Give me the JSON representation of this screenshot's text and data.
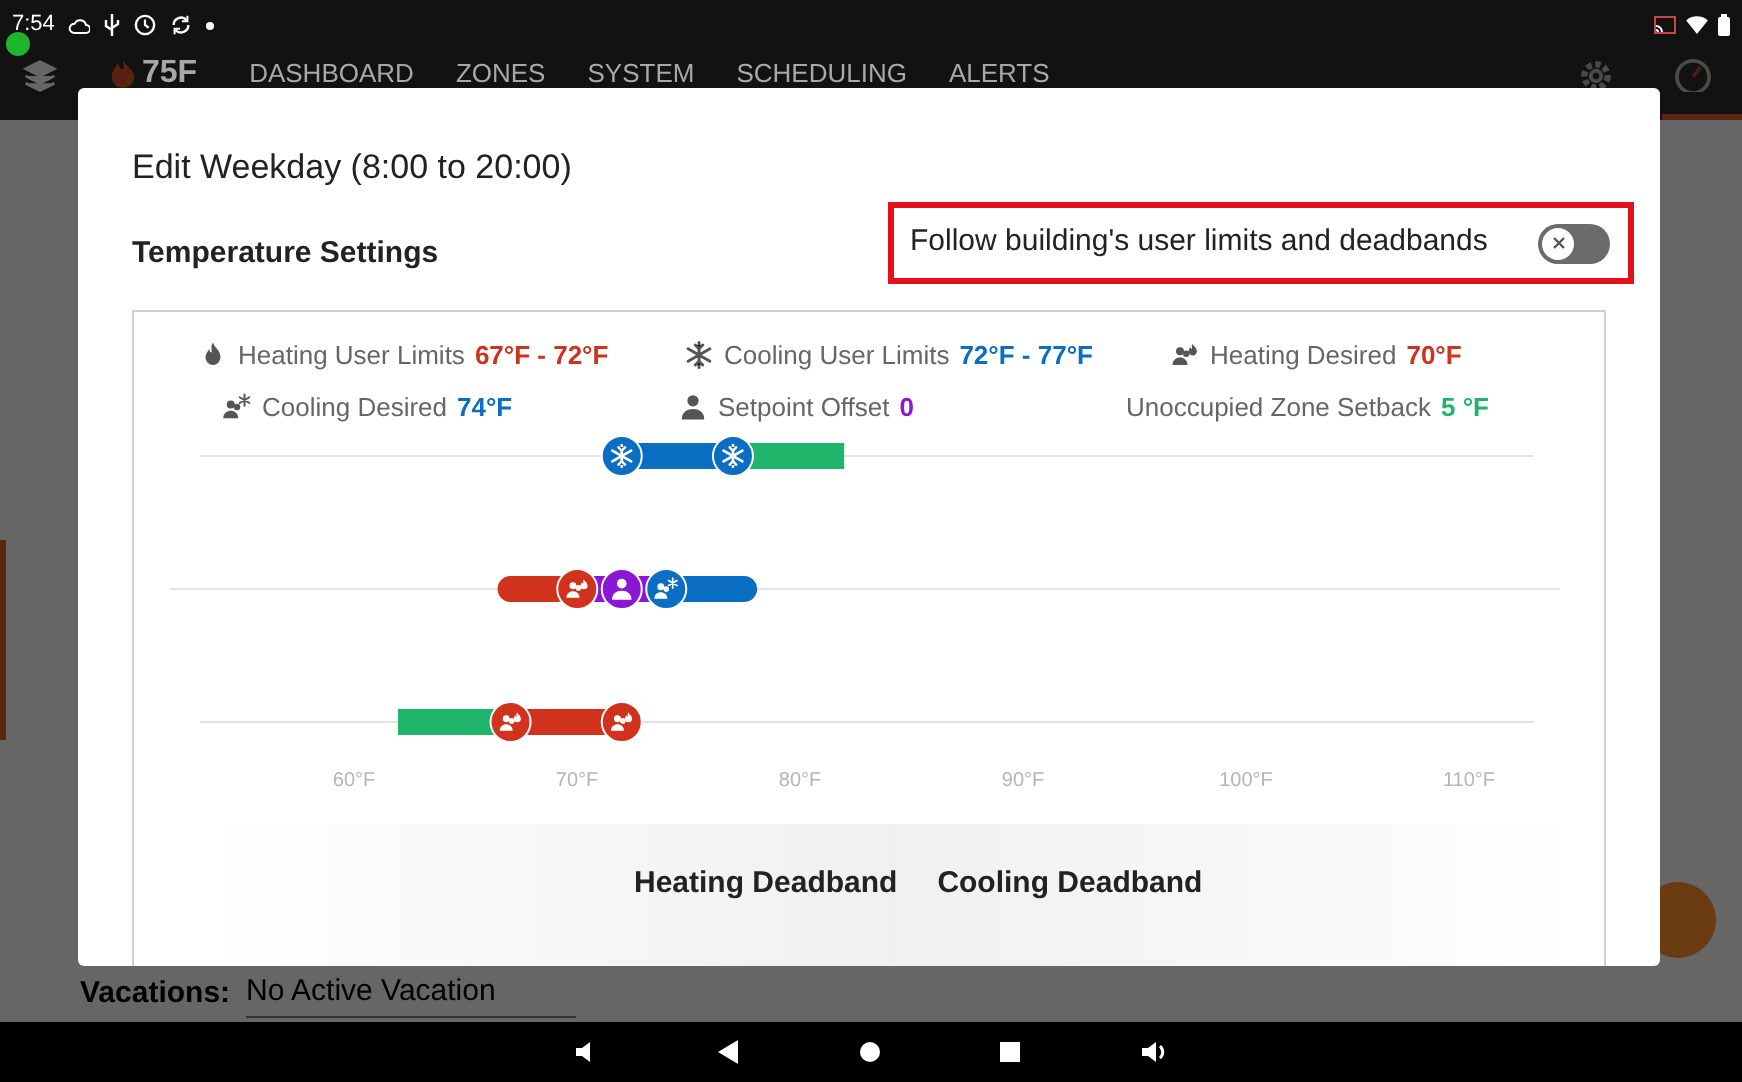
{
  "status_bar": {
    "time": "7:54"
  },
  "nav": {
    "logo": "75F",
    "items": [
      {
        "label": "DASHBOARD"
      },
      {
        "label": "ZONES"
      },
      {
        "label": "SYSTEM"
      },
      {
        "label": "SCHEDULING"
      },
      {
        "label": "ALERTS"
      }
    ]
  },
  "background": {
    "vacations_label": "Vacations:",
    "vacations_value": "No Active Vacation"
  },
  "dialog": {
    "title": "Edit Weekday (8:00 to 20:00)",
    "section": "Temperature Settings",
    "follow_toggle": {
      "label": "Follow building's user limits and deadbands",
      "on": false
    },
    "legend": [
      {
        "kind": "flame",
        "label": "Heating User Limits",
        "value": "67°F - 72°F",
        "color": "#d0321e"
      },
      {
        "kind": "snowflake",
        "label": "Cooling User Limits",
        "value": "72°F - 77°F",
        "color": "#0a6fc2"
      },
      {
        "kind": "heat-people",
        "label": "Heating Desired",
        "value": "70°F",
        "color": "#d0321e"
      },
      {
        "kind": "cool-people",
        "label": "Cooling Desired",
        "value": "74°F",
        "color": "#0a6fc2"
      },
      {
        "kind": "person",
        "label": "Setpoint Offset",
        "value": "0",
        "color": "#8a17d6"
      },
      {
        "kind": "none",
        "label": "Unoccupied Zone Setback",
        "value": "5 °F",
        "color": "#1fb56b"
      }
    ],
    "range_tracks": [
      {
        "stops": [
          {
            "kind": "snowflake",
            "level": 0.325,
            "color": "#0a6fc2"
          },
          {
            "kind": "snowflake",
            "level": 0.405,
            "color": "#0a6fc2"
          },
          {
            "kind": "edge",
            "level": 0.485
          }
        ],
        "segments": [
          {
            "color": "#0a6fc2"
          },
          {
            "color": "#1fb56b"
          }
        ]
      },
      {
        "stops": [
          {
            "kind": "end",
            "level": 0.245
          },
          {
            "kind": "heat-people",
            "level": 0.293,
            "color": "#d0321e"
          },
          {
            "kind": "person",
            "level": 0.325,
            "color": "#8a17d6"
          },
          {
            "kind": "cool-people",
            "level": 0.357,
            "color": "#0a6fc2"
          },
          {
            "kind": "end",
            "level": 0.413
          }
        ],
        "segments": [
          {
            "color": "#d0321e"
          },
          {
            "color": "#8a17d6"
          },
          {
            "color": "#8a17d6"
          },
          {
            "color": "#0a6fc2"
          }
        ]
      },
      {
        "stops": [
          {
            "kind": "edge",
            "level": 0.164
          },
          {
            "kind": "heat-people",
            "level": 0.245,
            "color": "#d0321e"
          },
          {
            "kind": "heat-people",
            "level": 0.325,
            "color": "#d0321e"
          }
        ],
        "segments": [
          {
            "color": "#1fb56b"
          },
          {
            "color": "#d0321e"
          }
        ]
      }
    ],
    "axis_labels": [
      "60°F",
      "70°F",
      "80°F",
      "90°F",
      "100°F",
      "110°F"
    ],
    "deadbands": [
      {
        "label": "Heating Deadband"
      },
      {
        "label": "Cooling Deadband"
      }
    ]
  }
}
